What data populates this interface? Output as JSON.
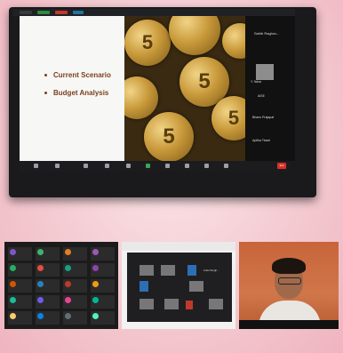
{
  "slide": {
    "bullets": [
      "Current Scenario",
      "Budget Analysis"
    ]
  },
  "coins": {
    "labels": [
      "5",
      "5",
      "5",
      "5"
    ]
  },
  "participants_panel": {
    "title": "Sahib Raghuv...",
    "entries": [
      "Y. Nava",
      "AISE",
      "Bhanu Prajapat",
      "Apitha Tiwari"
    ]
  },
  "zoom_toolbar": {
    "end_label": "End"
  },
  "gallery": {
    "colors": [
      "#7b57c7",
      "#3cb371",
      "#e67e22",
      "#9b59b6",
      "#27ae60",
      "#e74c3c",
      "#16a085",
      "#8e44ad",
      "#d35400",
      "#2980b9",
      "#c0392b",
      "#f39c12",
      "#1abc9c",
      "#6c5ce7",
      "#e84393",
      "#00b894",
      "#fdcb6e",
      "#0984e3",
      "#636e72",
      "#55efc4"
    ]
  },
  "mid_screen": {
    "header": "Ankit Singh..."
  }
}
